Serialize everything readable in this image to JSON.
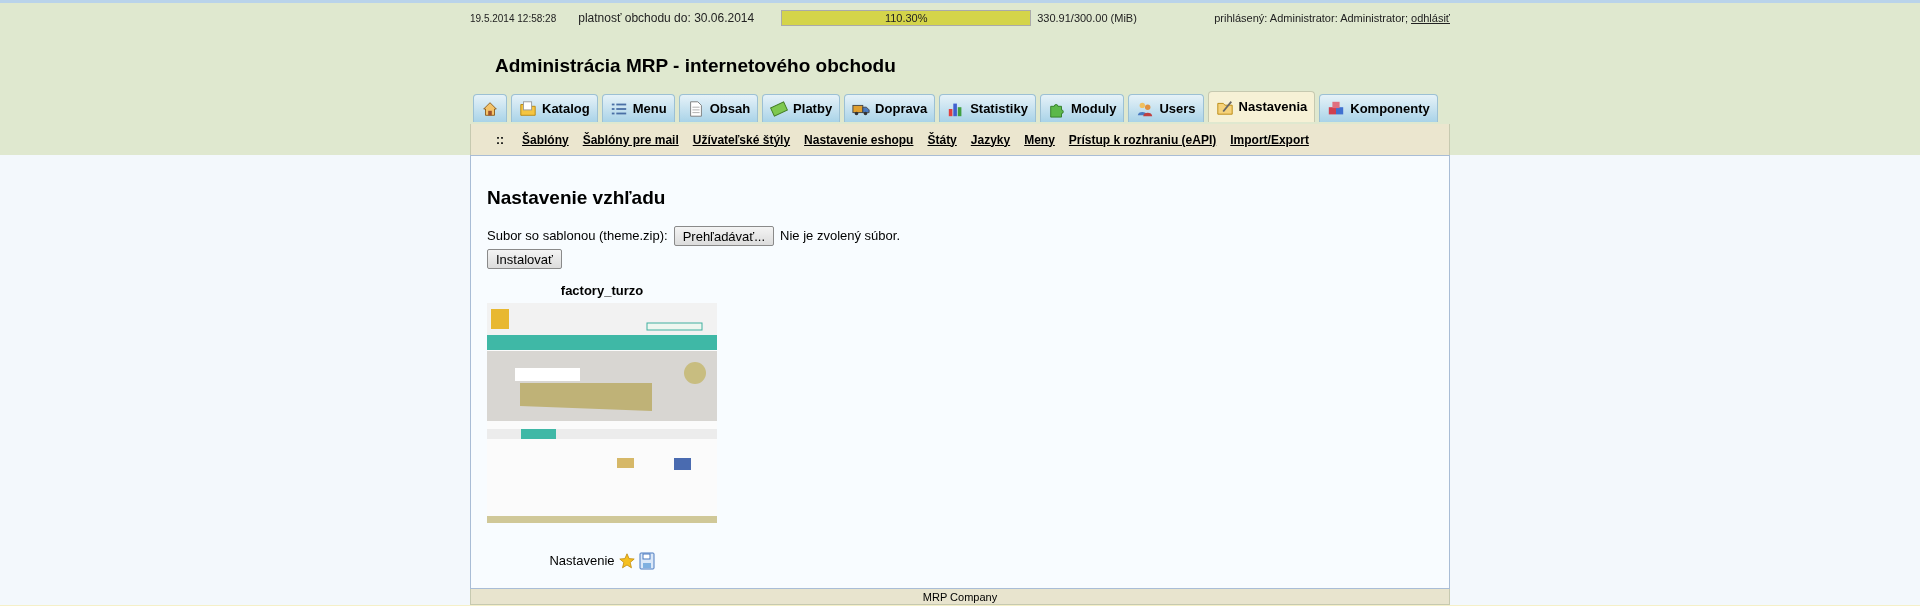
{
  "top_bar": {
    "datetime": "19.5.2014 12:58:28",
    "validity": "platnosť obchodu do: 30.06.2014",
    "storage": {
      "label": "110.30%",
      "level": 1,
      "reading": "330.91/300.00 (MiB)"
    },
    "logged_in": "prihlásený: Administrator: Administrator;",
    "logout": "odhlásiť"
  },
  "title": "Administrácia MRP - internetového obchodu",
  "tabs": [
    {
      "kind": "home",
      "selected": false
    },
    {
      "kind": "folder",
      "label": "Katalog",
      "selected": false
    },
    {
      "kind": "list",
      "label": "Menu",
      "selected": false
    },
    {
      "kind": "page",
      "label": "Obsah",
      "selected": false
    },
    {
      "kind": "money",
      "label": "Platby",
      "selected": false
    },
    {
      "kind": "truck",
      "label": "Doprava",
      "selected": false
    },
    {
      "kind": "chart",
      "label": "Statistiky",
      "selected": false
    },
    {
      "kind": "puzzle",
      "label": "Moduly",
      "selected": false
    },
    {
      "kind": "users",
      "label": "Users",
      "selected": false
    },
    {
      "kind": "settings",
      "label": "Nastavenia",
      "selected": true
    },
    {
      "kind": "cubes",
      "label": "Komponenty",
      "selected": false
    }
  ],
  "submenu": {
    "marker": "::",
    "items": [
      "Šablóny",
      "Šablóny pre mail",
      "Užívateľské štýly",
      "Nastavenie eshopu",
      "Štáty",
      "Jazyky",
      "Meny",
      "Prístup k rozhraniu (eAPI)",
      "Import/Export"
    ]
  },
  "content": {
    "heading": "Nastavenie vzhľadu",
    "file_label": "Subor so sablonou (theme.zip):",
    "browse_button": "Prehľadávať...",
    "no_file": "Nie je zvolený súbor.",
    "install_button": "Instalovať",
    "themes": [
      {
        "name": "factory_turzo",
        "settings_label": "Nastavenie"
      }
    ]
  },
  "footer": "MRP Company"
}
